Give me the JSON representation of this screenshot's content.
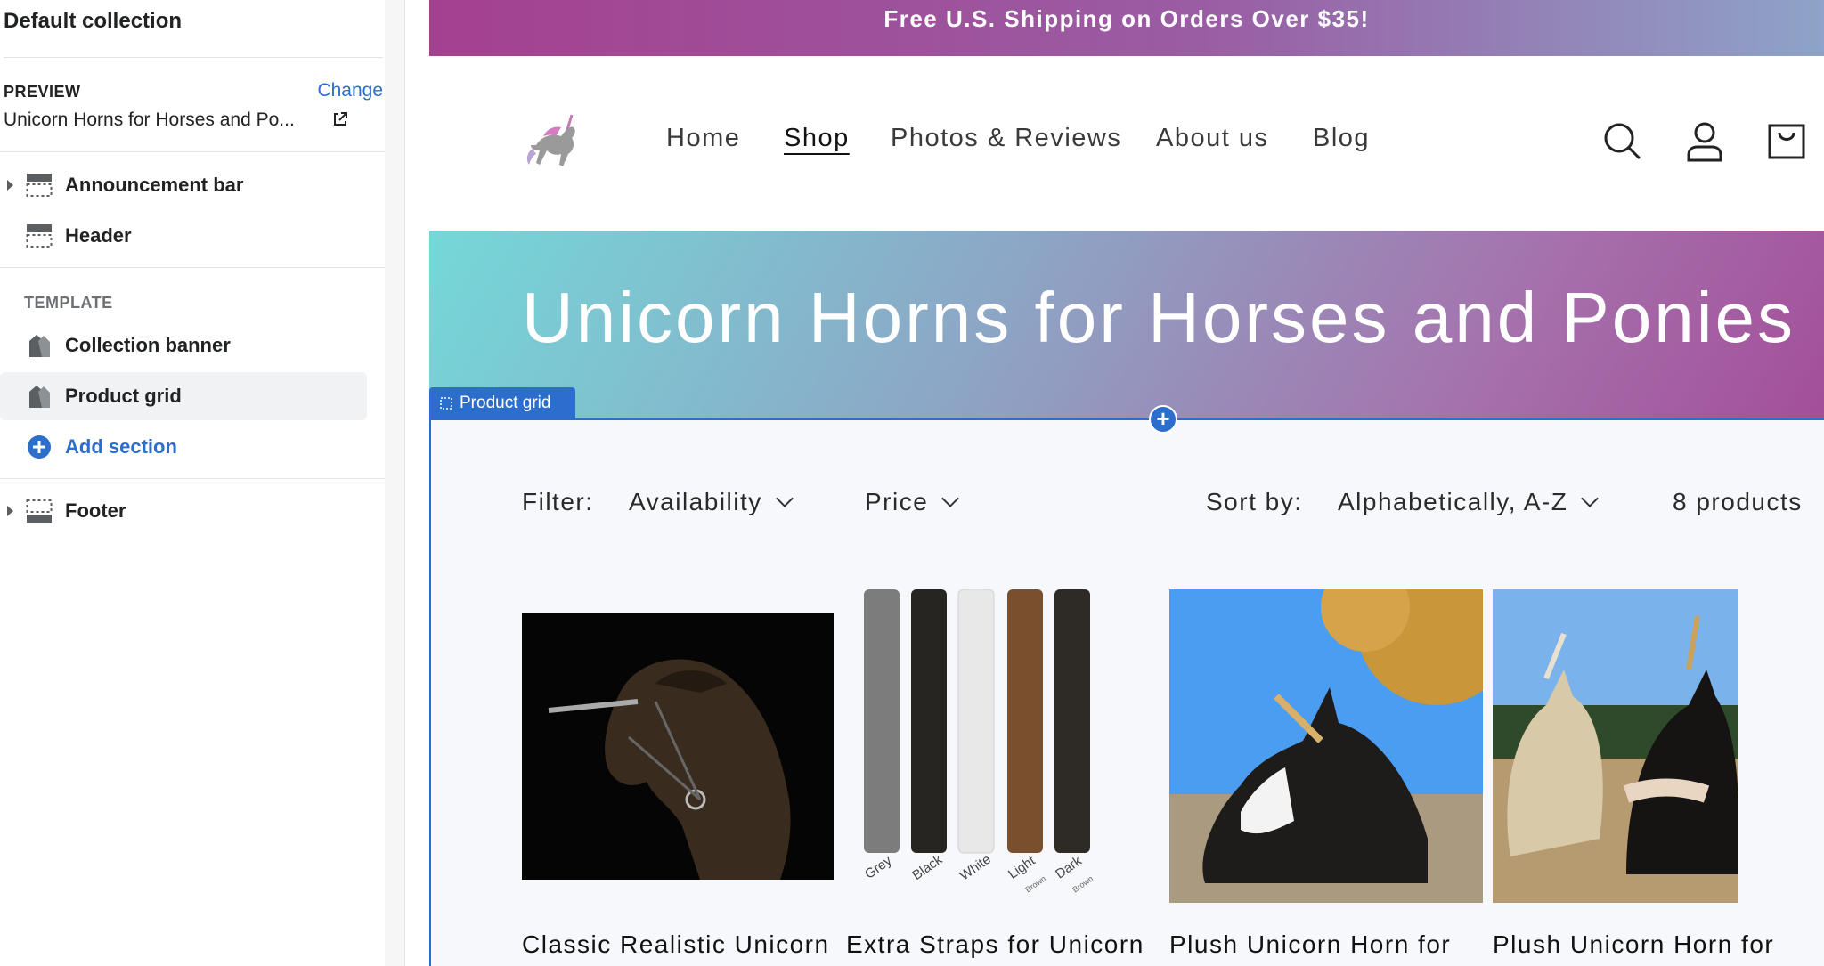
{
  "sidebar": {
    "title": "Default collection",
    "preview_label": "PREVIEW",
    "change_label": "Change",
    "preview_value": "Unicorn Horns for Horses and Po...",
    "items": [
      {
        "label": "Announcement bar"
      },
      {
        "label": "Header"
      }
    ],
    "template_label": "TEMPLATE",
    "template_items": [
      {
        "label": "Collection banner"
      },
      {
        "label": "Product grid"
      }
    ],
    "add_section_label": "Add section",
    "footer_label": "Footer"
  },
  "store": {
    "announcement": "Free U.S. Shipping on Orders Over $35!",
    "nav": [
      "Home",
      "Shop",
      "Photos & Reviews",
      "About us",
      "Blog"
    ],
    "active_nav": "Shop",
    "banner_title": "Unicorn Horns for Horses and Ponies",
    "section_tag": "Product grid",
    "filter_label": "Filter:",
    "filters": [
      "Availability",
      "Price"
    ],
    "sort_label": "Sort by:",
    "sort_value": "Alphabetically, A-Z",
    "product_count": "8 products",
    "straps_labels": [
      "Grey",
      "Black",
      "White",
      "Light",
      "Dark"
    ],
    "straps_sublabels": [
      "Brown",
      "Brown"
    ],
    "products": [
      {
        "title": "Classic Realistic Unicorn"
      },
      {
        "title": "Extra Straps for Unicorn"
      },
      {
        "title": "Plush Unicorn Horn for"
      },
      {
        "title": "Plush Unicorn Horn for"
      }
    ]
  },
  "colors": {
    "accent": "#2c6ecb",
    "announcement_start": "#a4418f",
    "banner_start": "#74d8d8",
    "banner_end": "#a34f98"
  },
  "icons": [
    "caret-right-icon",
    "section-icon",
    "template-icon",
    "add-circle-icon",
    "external-link-icon",
    "search-icon",
    "account-icon",
    "cart-icon",
    "chevron-down-icon",
    "unicorn-logo-icon"
  ]
}
